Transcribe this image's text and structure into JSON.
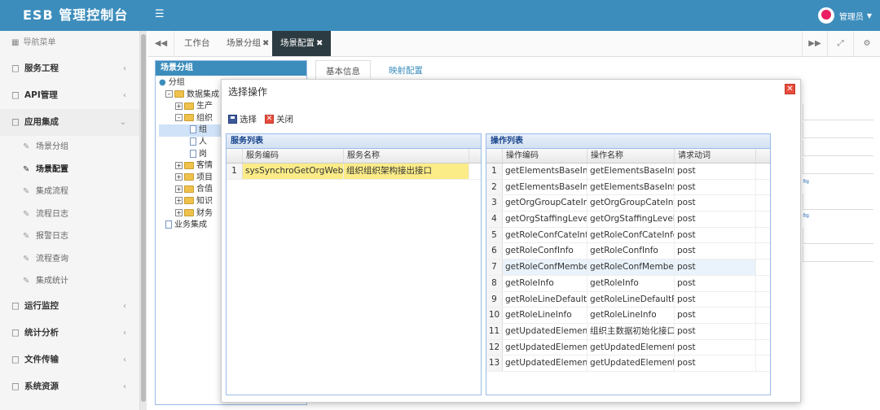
{
  "app": {
    "title": "ESB 管理控制台",
    "user": "管理员"
  },
  "sidebar": {
    "nav_label": "导航菜单",
    "items": [
      {
        "label": "服务工程"
      },
      {
        "label": "API管理"
      },
      {
        "label": "应用集成"
      }
    ],
    "subitems": [
      {
        "label": "场景分组"
      },
      {
        "label": "场景配置"
      },
      {
        "label": "集成流程"
      },
      {
        "label": "流程日志"
      },
      {
        "label": "报警日志"
      },
      {
        "label": "流程查询"
      },
      {
        "label": "集成统计"
      }
    ],
    "items2": [
      {
        "label": "运行监控"
      },
      {
        "label": "统计分析"
      },
      {
        "label": "文件传输"
      },
      {
        "label": "系统资源"
      }
    ]
  },
  "tabs": [
    {
      "label": "工作台"
    },
    {
      "label": "场景分组"
    },
    {
      "label": "场景配置"
    }
  ],
  "tree": {
    "header": "场景分组",
    "root": "分组",
    "nodes": [
      "数据集成",
      "生产",
      "组织",
      "组",
      "人",
      "岗",
      "客情",
      "项目",
      "合值",
      "知识",
      "财务",
      "业务集成"
    ]
  },
  "right_tabs": [
    "基本信息",
    "映射配置"
  ],
  "dialog": {
    "title": "选择操作",
    "select_label": "选择",
    "close_label": "关闭",
    "service_list": {
      "title": "服务列表",
      "col_code": "服务编码",
      "col_name": "服务名称",
      "rows": [
        {
          "n": "1",
          "code": "sysSynchroGetOrgWebSe",
          "name": "组织组织架构接出接口"
        }
      ]
    },
    "op_list": {
      "title": "操作列表",
      "col_code": "操作编码",
      "col_name": "操作名称",
      "col_method": "请求动词",
      "rows": [
        {
          "n": "1",
          "code": "getElementsBaseInfo",
          "name": "getElementsBaseInfo",
          "method": "post"
        },
        {
          "n": "2",
          "code": "getElementsBaseInfo",
          "name": "getElementsBaseInfoV",
          "method": "post"
        },
        {
          "n": "3",
          "code": "getOrgGroupCateInf",
          "name": "getOrgGroupCateInfo",
          "method": "post"
        },
        {
          "n": "4",
          "code": "getOrgStaffingLevelI",
          "name": "getOrgStaffingLevelIn",
          "method": "post"
        },
        {
          "n": "5",
          "code": "getRoleConfCateInfo",
          "name": "getRoleConfCateInfo",
          "method": "post"
        },
        {
          "n": "6",
          "code": "getRoleConfInfo",
          "name": "getRoleConfInfo",
          "method": "post"
        },
        {
          "n": "7",
          "code": "getRoleConfMemberI",
          "name": "getRoleConfMemberIn",
          "method": "post"
        },
        {
          "n": "8",
          "code": "getRoleInfo",
          "name": "getRoleInfo",
          "method": "post"
        },
        {
          "n": "9",
          "code": "getRoleLineDefaultRo",
          "name": "getRoleLineDefaultRol",
          "method": "post"
        },
        {
          "n": "10",
          "code": "getRoleLineInfo",
          "name": "getRoleLineInfo",
          "method": "post"
        },
        {
          "n": "11",
          "code": "getUpdatedElements",
          "name": "组织主数据初始化接口",
          "method": "post"
        },
        {
          "n": "12",
          "code": "getUpdatedElements",
          "name": "getUpdatedElementsB",
          "method": "post"
        },
        {
          "n": "13",
          "code": "getUpdatedElements",
          "name": "getUpdatedElementsV",
          "method": "post"
        }
      ]
    }
  }
}
